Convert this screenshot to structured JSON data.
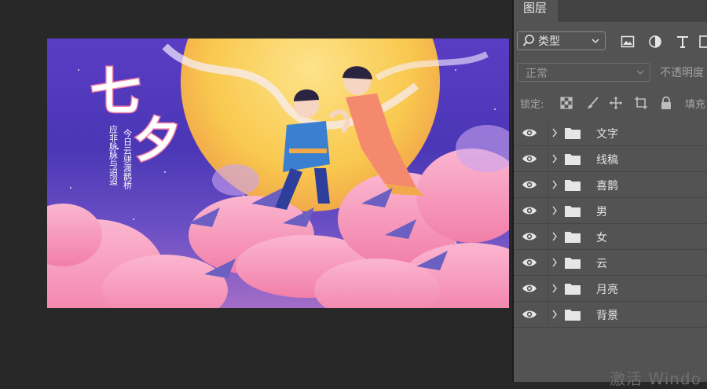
{
  "panel": {
    "tab_label": "图层",
    "filter": {
      "icon": "search-icon",
      "label": "类型"
    },
    "filter_icons": [
      "image-filter-icon",
      "adjustment-filter-icon",
      "text-filter-icon",
      "shape-filter-icon"
    ],
    "blend_mode": "正常",
    "opacity_label": "不透明度",
    "lock_label": "锁定:",
    "lock_icons": [
      "lock-transparent-pixels-icon",
      "lock-image-pixels-icon",
      "lock-position-icon",
      "lock-artboard-icon",
      "lock-all-icon"
    ],
    "fill_label": "填充",
    "layers": [
      {
        "name": "文字",
        "visible": true,
        "type": "group"
      },
      {
        "name": "线稿",
        "visible": true,
        "type": "group"
      },
      {
        "name": "喜鹊",
        "visible": true,
        "type": "group"
      },
      {
        "name": "男",
        "visible": true,
        "type": "group"
      },
      {
        "name": "女",
        "visible": true,
        "type": "group"
      },
      {
        "name": "云",
        "visible": true,
        "type": "group"
      },
      {
        "name": "月亮",
        "visible": true,
        "type": "group"
      },
      {
        "name": "背景",
        "visible": true,
        "type": "group"
      }
    ]
  },
  "artwork": {
    "title_char1": "七",
    "title_char2": "夕",
    "poem_col1": "今日云骈渡鹊桥",
    "poem_col2": "应非脉脉与迢迢"
  },
  "watermark": "激活 Windo",
  "colors": {
    "panel_bg": "#535353",
    "workspace_bg": "#282828",
    "moon": "#f9c94f",
    "clouds": "#f59ab8",
    "sky": "#4a37b5"
  }
}
